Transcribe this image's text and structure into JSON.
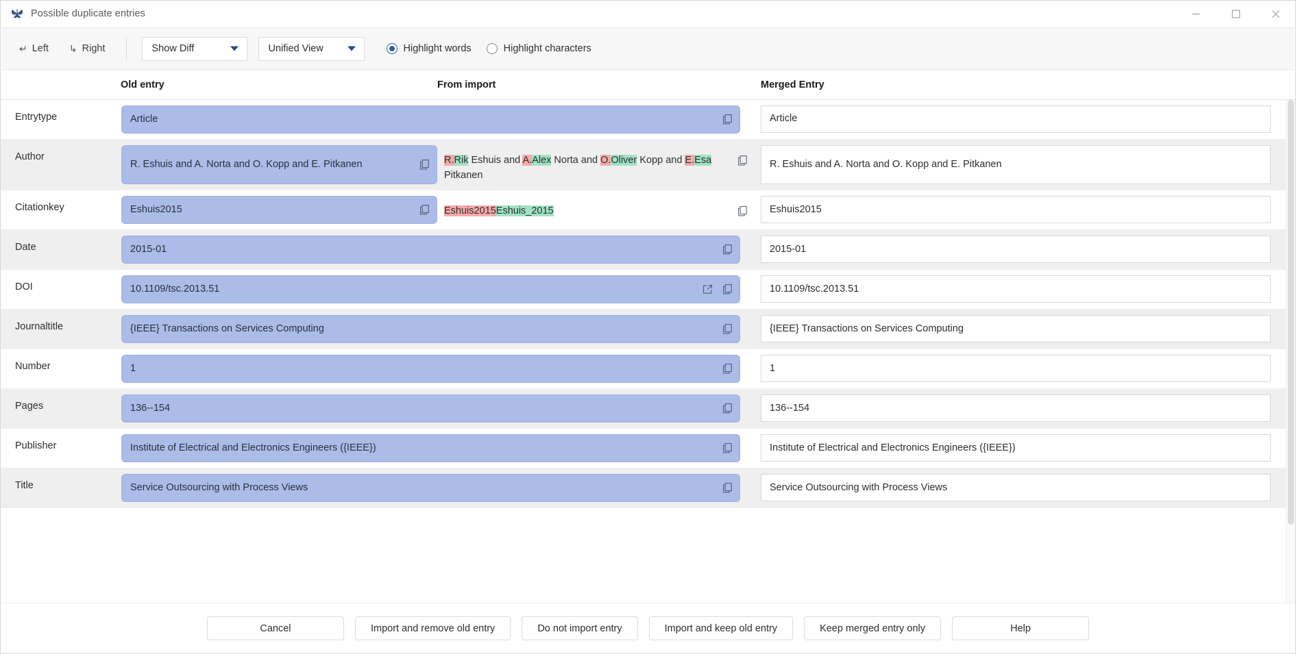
{
  "window": {
    "title": "Possible duplicate entries",
    "app_icon": "butterfly-icon",
    "minimize": "—",
    "maximize": "☐",
    "close": "✕"
  },
  "toolbar": {
    "left_label": "Left",
    "left_arrow": "↵",
    "right_label": "Right",
    "right_arrow": "↳",
    "diff_mode": "Show Diff",
    "view_mode": "Unified View",
    "highlight_words": "Highlight words",
    "highlight_characters": "Highlight characters",
    "highlight_selected": "words"
  },
  "headers": {
    "label": "",
    "old": "Old entry",
    "import": "From import",
    "merged": "Merged Entry"
  },
  "rows": [
    {
      "label": "Entrytype",
      "old": "Article",
      "merged": "Article",
      "import_segments": [],
      "has_import": false,
      "has_link": false,
      "tall": false
    },
    {
      "label": "Author",
      "old": "R. Eshuis and A. Norta and O. Kopp and E. Pitkanen",
      "merged": "R. Eshuis and A. Norta and O. Kopp and E. Pitkanen",
      "import_segments": [
        {
          "t": "R.",
          "k": "del"
        },
        {
          "t": "Rik",
          "k": "ins"
        },
        {
          "t": " Eshuis and ",
          "k": "eq"
        },
        {
          "t": "A.",
          "k": "del"
        },
        {
          "t": "Alex",
          "k": "ins"
        },
        {
          "t": " Norta and ",
          "k": "eq"
        },
        {
          "t": "O.",
          "k": "del"
        },
        {
          "t": "Oliver",
          "k": "ins"
        },
        {
          "t": " Kopp and ",
          "k": "eq"
        },
        {
          "t": "E.",
          "k": "del"
        },
        {
          "t": "Esa",
          "k": "ins"
        },
        {
          "t": " Pitkanen",
          "k": "eq"
        }
      ],
      "has_import": true,
      "has_link": false,
      "tall": true
    },
    {
      "label": "Citationkey",
      "old": "Eshuis2015",
      "merged": "Eshuis2015",
      "import_segments": [
        {
          "t": "Eshuis2015",
          "k": "del"
        },
        {
          "t": "Eshuis_2015",
          "k": "ins"
        }
      ],
      "has_import": true,
      "has_link": false,
      "tall": false
    },
    {
      "label": "Date",
      "old": "2015-01",
      "merged": "2015-01",
      "import_segments": [],
      "has_import": false,
      "has_link": false,
      "tall": false
    },
    {
      "label": "DOI",
      "old": "10.1109/tsc.2013.51",
      "merged": "10.1109/tsc.2013.51",
      "import_segments": [],
      "has_import": false,
      "has_link": true,
      "tall": false
    },
    {
      "label": "Journaltitle",
      "old": "{IEEE} Transactions on Services Computing",
      "merged": "{IEEE} Transactions on Services Computing",
      "import_segments": [],
      "has_import": false,
      "has_link": false,
      "tall": false
    },
    {
      "label": "Number",
      "old": "1",
      "merged": "1",
      "import_segments": [],
      "has_import": false,
      "has_link": false,
      "tall": false
    },
    {
      "label": "Pages",
      "old": "136--154",
      "merged": "136--154",
      "import_segments": [],
      "has_import": false,
      "has_link": false,
      "tall": false
    },
    {
      "label": "Publisher",
      "old": "Institute of Electrical and Electronics Engineers ({IEEE})",
      "merged": "Institute of Electrical and Electronics Engineers ({IEEE})",
      "import_segments": [],
      "has_import": false,
      "has_link": false,
      "tall": false
    },
    {
      "label": "Title",
      "old": "Service Outsourcing with Process Views",
      "merged": "Service Outsourcing with Process Views",
      "import_segments": [],
      "has_import": false,
      "has_link": false,
      "tall": false
    }
  ],
  "footer": {
    "buttons": [
      "Cancel",
      "Import and remove old entry",
      "Do not import entry",
      "Import and keep old entry",
      "Keep merged entry only",
      "Help"
    ]
  },
  "colors": {
    "old_field_bg": "#acbce8",
    "diff_deleted": "#f5a9a9",
    "diff_inserted": "#9fe3c3",
    "accent": "#2e5fa3",
    "alt_row_bg": "#efefef"
  }
}
